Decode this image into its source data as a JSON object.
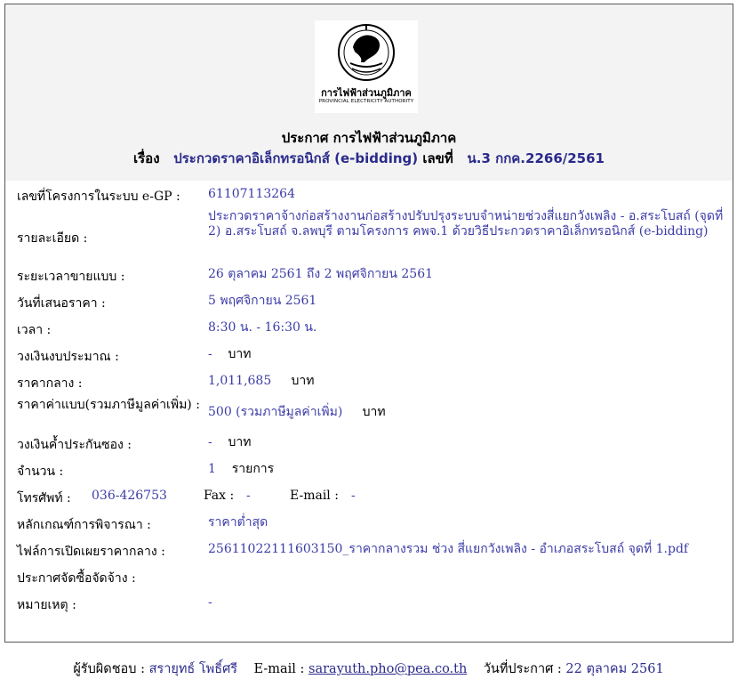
{
  "logo": {
    "name_th": "การไฟฟ้าส่วนภูมิภาค",
    "name_en": "PROVINCIAL ELECTRICITY AUTHORITY"
  },
  "announcement": {
    "title": "ประกาศ การไฟฟ้าส่วนภูมิภาค",
    "subject_label": "เรื่อง",
    "subject": "ประกวดราคาอิเล็กทรอนิกส์ (e-bidding)",
    "number_label": "เลขที่",
    "number": "น.3 กกค.2266/2561"
  },
  "details": {
    "project_id_label": "เลขที่โครงการในระบบ e-GP :",
    "project_id": "61107113264",
    "description_label": "รายละเอียด :",
    "description": "ประกวดราคาจ้างก่อสร้างงานก่อสร้างปรับปรุงระบบจำหน่ายช่วงสี่แยกวังเพลิง - อ.สระโบสถ์ (จุดที่ 2) อ.สระโบสถ์ จ.ลพบุรี ตามโครงการ คพจ.1 ด้วยวิธีประกวดราคาอิเล็กทรอนิกส์ (e-bidding)",
    "sale_period_label": "ระยะเวลาขายแบบ :",
    "sale_period": "26 ตุลาคม 2561 ถึง 2 พฤศจิกายน 2561",
    "bid_date_label": "วันที่เสนอราคา :",
    "bid_date": "5 พฤศจิกายน 2561",
    "time_label": "เวลา :",
    "time": "8:30 น. - 16:30 น.",
    "budget_label": "วงเงินงบประมาณ :",
    "budget": "-",
    "budget_unit": "บาท",
    "median_price_label": "ราคากลาง :",
    "median_price": "1,011,685",
    "median_price_unit": "บาท",
    "doc_price_label": "ราคาค่าแบบ(รวมภาษีมูลค่าเพิ่ม) :",
    "doc_price": "500 (รวมภาษีมูลค่าเพิ่ม)",
    "doc_price_unit": "บาท",
    "guarantee_label": "วงเงินค้ำประกันซอง :",
    "guarantee": "-",
    "guarantee_unit": "บาท",
    "quantity_label": "จำนวน :",
    "quantity": "1",
    "quantity_unit": "รายการ",
    "phone_label": "โทรศัพท์ :",
    "phone": "036-426753",
    "fax_label": "Fax :",
    "fax": "-",
    "email_label": "E-mail :",
    "email": "-",
    "criteria_label": "หลักเกณฑ์การพิจารณา :",
    "criteria": "ราคาต่ำสุด",
    "file_label": "ไฟล์การเปิดเผยราคากลาง :",
    "file": "25611022111603150_ราคากลางรวม ช่วง สี่แยกวังเพลิง - อำเภอสระโบสถ์ จุดที่ 1.pdf",
    "procurement_label": "ประกาศจัดซื้อจัดจ้าง :",
    "remark_label": "หมายเหตุ :",
    "remark": "-"
  },
  "footer": {
    "responsible_label": "ผู้รับผิดชอบ :",
    "responsible": "สรายุทธ์ โพธิ์ศรี",
    "email_label": "E-mail :",
    "email": "sarayuth.pho@pea.co.th",
    "date_label": "วันที่ประกาศ :",
    "date": "22 ตุลาคม 2561"
  }
}
